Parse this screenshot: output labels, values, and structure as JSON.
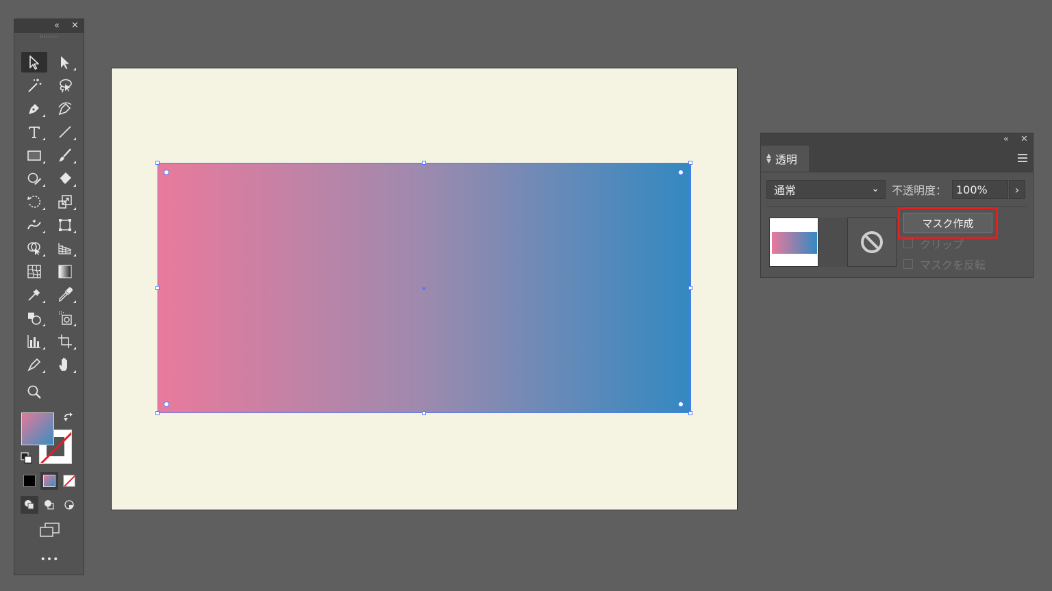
{
  "tools_panel": {
    "collapse_icon": "«",
    "close_icon": "✕",
    "tools": [
      {
        "name": "selection-tool-icon",
        "active": true
      },
      {
        "name": "direct-selection-tool-icon"
      },
      {
        "name": "magic-wand-tool-icon"
      },
      {
        "name": "lasso-tool-icon"
      },
      {
        "name": "pen-tool-icon"
      },
      {
        "name": "curvature-tool-icon"
      },
      {
        "name": "type-tool-icon"
      },
      {
        "name": "line-segment-tool-icon"
      },
      {
        "name": "rectangle-tool-icon"
      },
      {
        "name": "paintbrush-tool-icon"
      },
      {
        "name": "shaper-tool-icon"
      },
      {
        "name": "eraser-tool-icon"
      },
      {
        "name": "rotate-tool-icon"
      },
      {
        "name": "scale-tool-icon"
      },
      {
        "name": "width-tool-icon"
      },
      {
        "name": "free-transform-tool-icon"
      },
      {
        "name": "shape-builder-tool-icon"
      },
      {
        "name": "perspective-grid-tool-icon"
      },
      {
        "name": "mesh-tool-icon"
      },
      {
        "name": "gradient-tool-icon"
      },
      {
        "name": "eyedropper-blend-tool-icon"
      },
      {
        "name": "eyedropper-tool-icon"
      },
      {
        "name": "symbol-sprayer-tool-icon"
      },
      {
        "name": "symbol-tool-icon"
      },
      {
        "name": "column-graph-tool-icon"
      },
      {
        "name": "artboard-tool-icon"
      },
      {
        "name": "slice-tool-icon"
      },
      {
        "name": "hand-tool-icon"
      },
      {
        "name": "zoom-tool-icon"
      }
    ],
    "more_label": "•••"
  },
  "transparency_panel": {
    "collapse_icon": "«",
    "close_icon": "✕",
    "tab_label": "透明",
    "blend_mode": "通常",
    "opacity_label": "不透明度：",
    "opacity_value": "100%",
    "make_mask_label": "マスク作成",
    "clip_label": "クリップ",
    "invert_mask_label": "マスクを反転"
  },
  "colors": {
    "gradient_start": "#e97a9c",
    "gradient_end": "#3389c1",
    "selection": "#4c7cff",
    "highlight": "#e32020"
  }
}
